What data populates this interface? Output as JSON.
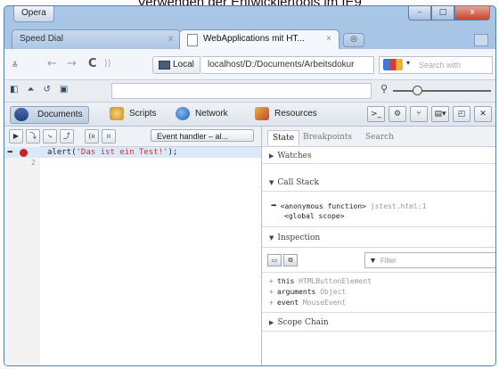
{
  "caption": "Verwenden der Entwicklertools im IE9",
  "window": {
    "opera_button": "Opera",
    "controls": [
      "–",
      "□",
      "x"
    ]
  },
  "tabs": [
    {
      "label": "Speed Dial",
      "close": "x"
    },
    {
      "label": "WebApplications mit HT...",
      "close": "×"
    }
  ],
  "address": {
    "back": "←",
    "forward": "→",
    "reload": "C",
    "local_label": "Local",
    "url": "localhost/D:/Documents/Arbeitsdokur",
    "search_placeholder": "Search with"
  },
  "devtools": {
    "top_icons": [
      "◧",
      "⏶",
      "↺",
      "▣"
    ],
    "search_value": "",
    "magnifier": "⚲",
    "panel_tabs": [
      "Documents",
      "Scripts",
      "Network",
      "Resources"
    ],
    "panel_tools": [
      ">_",
      "⚙",
      "⑂",
      "▤▾",
      "◰",
      "✕"
    ]
  },
  "script_pane": {
    "toolbar_buttons": [
      "▶",
      "⤵",
      "⤷",
      "⤴",
      "(ıı",
      "ıı"
    ],
    "event_select": "Event handler – al...",
    "lines": [
      {
        "num": "1",
        "code_prefix": "alert(",
        "code_string": "'Das ist ein Test!'",
        "code_suffix": ");"
      },
      {
        "num": "2",
        "code_prefix": "",
        "code_string": "",
        "code_suffix": ""
      }
    ]
  },
  "inspector": {
    "tabs": [
      "State",
      "Breakpoints",
      "Search"
    ],
    "watches": "Watches",
    "call_stack": "Call Stack",
    "stack": [
      {
        "fn": "<anonymous function>",
        "loc": "jstest.html:1"
      },
      {
        "fn": "<global scope>",
        "loc": ""
      }
    ],
    "inspection": "Inspection",
    "filter_placeholder": "Filter",
    "properties": [
      {
        "name": "this",
        "value": "HTMLButtonElement"
      },
      {
        "name": "arguments",
        "value": "Object"
      },
      {
        "name": "event",
        "value": "MouseEvent"
      }
    ],
    "scope_chain": "Scope Chain"
  }
}
